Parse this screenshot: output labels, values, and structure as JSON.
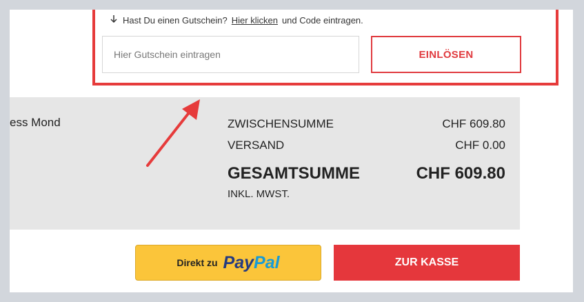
{
  "voucher": {
    "hint_prefix": "Hast Du einen Gutschein?",
    "hint_link": "Hier klicken",
    "hint_suffix": "und Code eintragen.",
    "input_placeholder": "Hier Gutschein eintragen",
    "input_value": "",
    "redeem_label": "EINLÖSEN",
    "highlight_color": "#e63b3b"
  },
  "summary": {
    "product_name_partial": "ess Mond",
    "subtotal_label": "ZWISCHENSUMME",
    "subtotal_value": "CHF 609.80",
    "shipping_label": "VERSAND",
    "shipping_value": "CHF 0.00",
    "total_label": "GESAMTSUMME",
    "total_value": "CHF 609.80",
    "vat_note": "INKL. MWST."
  },
  "actions": {
    "paypal_prefix": "Direkt zu",
    "paypal_brand_1": "Pay",
    "paypal_brand_2": "Pal",
    "checkout_label": "ZUR KASSE"
  },
  "icons": {
    "hint_icon": "arrow-down-icon",
    "annotation": "pointer-arrow-icon"
  },
  "colors": {
    "accent_red": "#e5373c",
    "paypal_yellow": "#fbc53a",
    "paypal_dark_blue": "#253b80",
    "paypal_light_blue": "#179bd7",
    "summary_bg": "#e6e6e6"
  }
}
